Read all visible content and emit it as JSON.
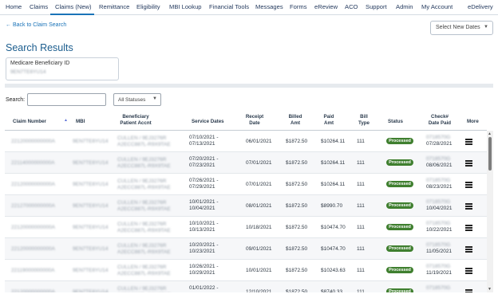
{
  "nav": {
    "items": [
      "Home",
      "Claims",
      "Claims (New)",
      "Remittance",
      "Eligibility",
      "MBI Lookup",
      "Financial Tools",
      "Messages",
      "Forms",
      "eReview",
      "ACO",
      "Support",
      "Admin",
      "My Account",
      "eDelivery"
    ],
    "active": "Claims (New)"
  },
  "back_link": "← Back to Claim Search",
  "date_select": "Select New Dates",
  "page_title": "Search Results",
  "mbi": {
    "label": "Medicare Beneficiary ID",
    "value": "9EN7TE6YU14"
  },
  "search": {
    "label": "Search:",
    "value": "",
    "status_filter": "All Statuses"
  },
  "table": {
    "headers": {
      "claim_number": "Claim Number",
      "mbi": "MBI",
      "beneficiary_l1": "Beneficiary",
      "beneficiary_l2": "Patient Accnt",
      "service_dates": "Service Dates",
      "receipt_l1": "Receipt",
      "receipt_l2": "Date",
      "billed_l1": "Billed",
      "billed_l2": "Amt",
      "paid_l1": "Paid",
      "paid_l2": "Amt",
      "bill_l1": "Bill",
      "bill_l2": "Type",
      "status": "Status",
      "check_l1": "Check#",
      "check_l2": "Date Paid",
      "more": "More"
    },
    "rows": [
      {
        "claim": "22120000000000A",
        "mbi": "9EN7TE6YU14",
        "benef_1": "CULLEN / 9EJ3276R",
        "benef_2": "A2ECC887L-R9X9TAE",
        "svc_1": "07/10/2021 -",
        "svc_2": "07/13/2021",
        "receipt": "06/01/2021",
        "billed": "$1872.50",
        "paid": "$10264.11",
        "bill_type": "111",
        "status": "Processed",
        "check": "0718570G",
        "date_paid": "07/28/2021"
      },
      {
        "claim": "22114000000000A",
        "mbi": "9EN7TE6YU14",
        "benef_1": "CULLEN / 9EJ3276R",
        "benef_2": "A2ECC887L-R9X9TAE",
        "svc_1": "07/20/2021 -",
        "svc_2": "07/23/2021",
        "receipt": "07/01/2021",
        "billed": "$1872.50",
        "paid": "$10264.11",
        "bill_type": "111",
        "status": "Processed",
        "check": "0718570G",
        "date_paid": "08/06/2021"
      },
      {
        "claim": "22120000000000A",
        "mbi": "9EN7TE6YU14",
        "benef_1": "CULLEN / 9EJ3276R",
        "benef_2": "A2ECC887L-R9X9TAE",
        "svc_1": "07/26/2021 -",
        "svc_2": "07/29/2021",
        "receipt": "07/01/2021",
        "billed": "$1872.50",
        "paid": "$10264.11",
        "bill_type": "111",
        "status": "Processed",
        "check": "0718570G",
        "date_paid": "08/23/2021"
      },
      {
        "claim": "22127000000000A",
        "mbi": "9EN7TE6YU14",
        "benef_1": "CULLEN / 9EJ3276R",
        "benef_2": "A2ECC887L-R9X9TAE",
        "svc_1": "10/01/2021 -",
        "svc_2": "10/04/2021",
        "receipt": "08/01/2021",
        "billed": "$1872.50",
        "paid": "$8990.70",
        "bill_type": "111",
        "status": "Processed",
        "check": "0718570G",
        "date_paid": "10/04/2021"
      },
      {
        "claim": "22120000000000A",
        "mbi": "9EN7TE6YU14",
        "benef_1": "CULLEN / 9EJ3276R",
        "benef_2": "A2ECC887L-R9X9TAE",
        "svc_1": "10/10/2021 -",
        "svc_2": "10/13/2021",
        "receipt": "10/18/2021",
        "billed": "$1872.50",
        "paid": "$10474.70",
        "bill_type": "111",
        "status": "Processed",
        "check": "0718570G",
        "date_paid": "10/22/2021"
      },
      {
        "claim": "22120000000000A",
        "mbi": "9EN7TE6YU14",
        "benef_1": "CULLEN / 9EJ3276R",
        "benef_2": "A2ECC887L-R9X9TAE",
        "svc_1": "10/20/2021 -",
        "svc_2": "10/23/2021",
        "receipt": "09/01/2021",
        "billed": "$1872.50",
        "paid": "$10474.70",
        "bill_type": "111",
        "status": "Processed",
        "check": "0718570G",
        "date_paid": "11/05/2021"
      },
      {
        "claim": "22119000000000A",
        "mbi": "9EN7TE6YU14",
        "benef_1": "CULLEN / 9EJ3276R",
        "benef_2": "A2ECC887L-R9X9TAE",
        "svc_1": "10/26/2021 -",
        "svc_2": "10/29/2021",
        "receipt": "10/01/2021",
        "billed": "$1872.50",
        "paid": "$10243.63",
        "bill_type": "111",
        "status": "Processed",
        "check": "0718570G",
        "date_paid": "11/19/2021"
      },
      {
        "claim": "22120000000000A",
        "mbi": "9EN7TE6YU14",
        "benef_1": "CULLEN / 9EJ3276R",
        "benef_2": "A2ECC887L-R9X9TAE",
        "svc_1": "01/01/2022 -",
        "svc_2": "",
        "receipt": "12/10/2021",
        "billed": "$1872.50",
        "paid": "$8740.33",
        "bill_type": "111",
        "status": "Processed",
        "check": "0718570G",
        "date_paid": ""
      }
    ]
  },
  "colors": {
    "accent": "#1a73b8",
    "title": "#1b5d8e",
    "badge": "#3f7f2f",
    "band": "#e6eaee"
  }
}
